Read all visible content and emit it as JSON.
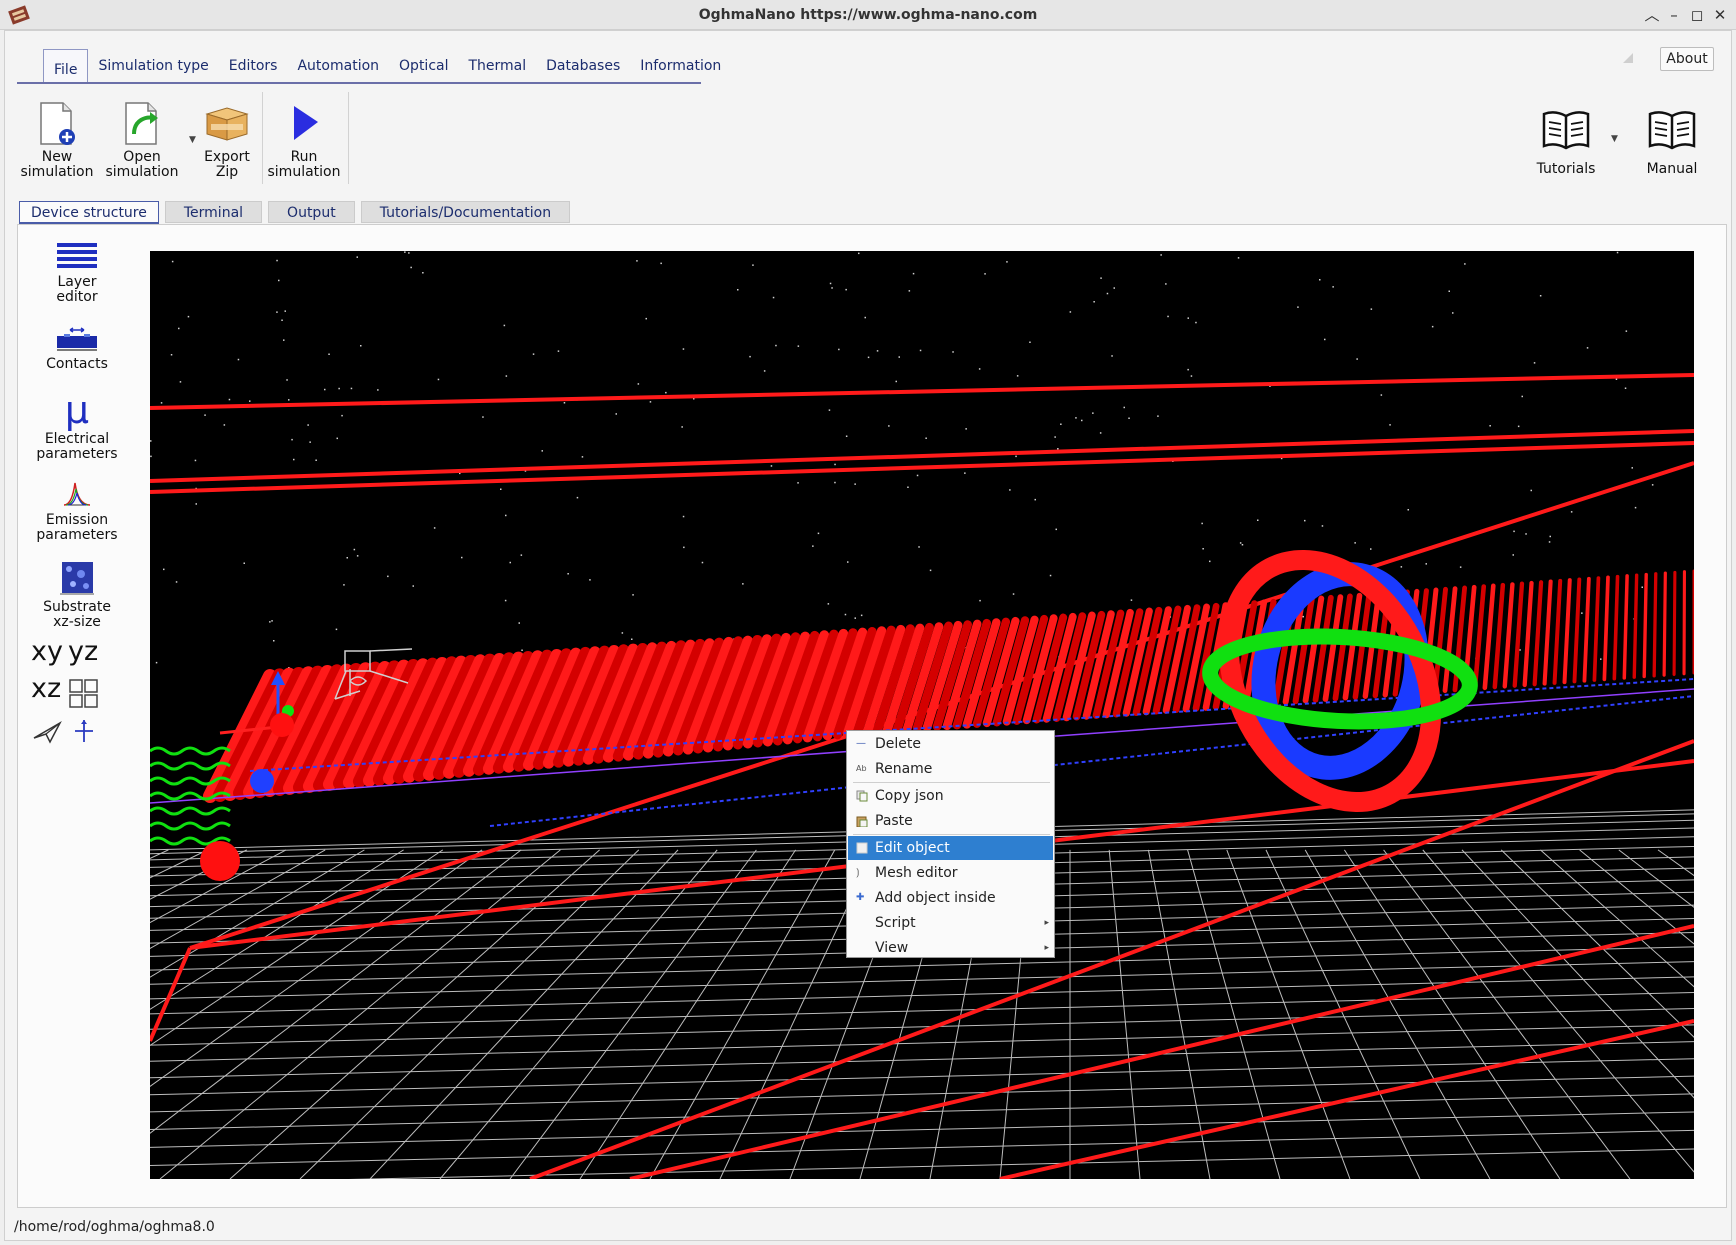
{
  "window": {
    "title": "OghmaNano https://www.oghma-nano.com"
  },
  "ribbon": {
    "tabs": [
      "File",
      "Simulation type",
      "Editors",
      "Automation",
      "Optical",
      "Thermal",
      "Databases",
      "Information"
    ],
    "active_tab": "File",
    "about_label": "About"
  },
  "toolbar": {
    "new_simulation": [
      "New",
      "simulation"
    ],
    "open_simulation": [
      "Open",
      "simulation"
    ],
    "export_zip": [
      "Export",
      "Zip"
    ],
    "run_simulation": [
      "Run",
      "simulation"
    ],
    "tutorials": "Tutorials",
    "manual": "Manual"
  },
  "doc_tabs": [
    "Device structure",
    "Terminal",
    "Output",
    "Tutorials/Documentation"
  ],
  "side_tools": {
    "layer_editor": [
      "Layer",
      "editor"
    ],
    "contacts": "Contacts",
    "electrical_parameters": [
      "Electrical",
      "parameters"
    ],
    "emission_parameters": [
      "Emission",
      "parameters"
    ],
    "substrate": [
      "Substrate",
      "xz-size"
    ],
    "xy": "xy",
    "yz": "yz",
    "xz": "xz",
    "mu_symbol": "μ"
  },
  "context_menu": {
    "items": [
      {
        "label": "Delete",
        "icon": "minus-icon"
      },
      {
        "label": "Rename",
        "icon": "rename-icon"
      },
      {
        "label": "Copy json",
        "icon": "copy-icon"
      },
      {
        "label": "Paste",
        "icon": "paste-icon"
      },
      {
        "label": "Edit object",
        "icon": "edit-icon",
        "selected": true
      },
      {
        "label": "Mesh editor",
        "icon": "mesh-icon"
      },
      {
        "label": "Add object inside",
        "icon": "plus-icon"
      },
      {
        "label": "Script",
        "submenu": true
      },
      {
        "label": "View",
        "submenu": true
      }
    ],
    "icon_glyphs": {
      "minus": "—",
      "rename": "Ab",
      "plus": "✚",
      "mesh": "⟯"
    },
    "submenu_arrow": "▸"
  },
  "statusbar": {
    "path": "/home/rod/oghma/oghma8.0"
  },
  "colors": {
    "accent": "#2e7fd0",
    "tab_text": "#1c2d6e",
    "scene_red": "#e00000",
    "scene_blue": "#1030ff",
    "scene_green": "#10e010"
  }
}
